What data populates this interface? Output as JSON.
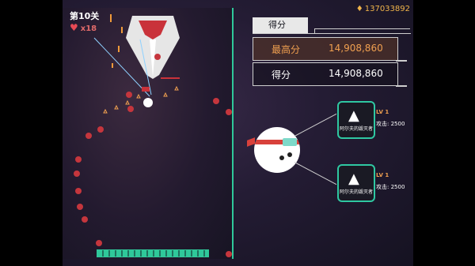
{
  "hud": {
    "stage": "第10关",
    "lives": "x18",
    "currency": "137033892"
  },
  "scoreboard": {
    "title": "得分",
    "high_label": "最高分",
    "high_value": "14,908,860",
    "current_label": "得分",
    "current_value": "14,908,860"
  },
  "weapons": [
    {
      "name": "阿尔夫的毁灭者",
      "level": "LV 1",
      "attack": "攻击: 2500"
    },
    {
      "name": "阿尔夫的毁灭者",
      "level": "LV 1",
      "attack": "攻击: 2500"
    }
  ],
  "colors": {
    "accent": "#2fc89a",
    "orb": "#c5363d",
    "gold": "#f0b44a"
  },
  "icons": [
    "heart-icon",
    "gem-icon",
    "boss-ship-icon",
    "player-ship-icon",
    "weapon-icon"
  ]
}
